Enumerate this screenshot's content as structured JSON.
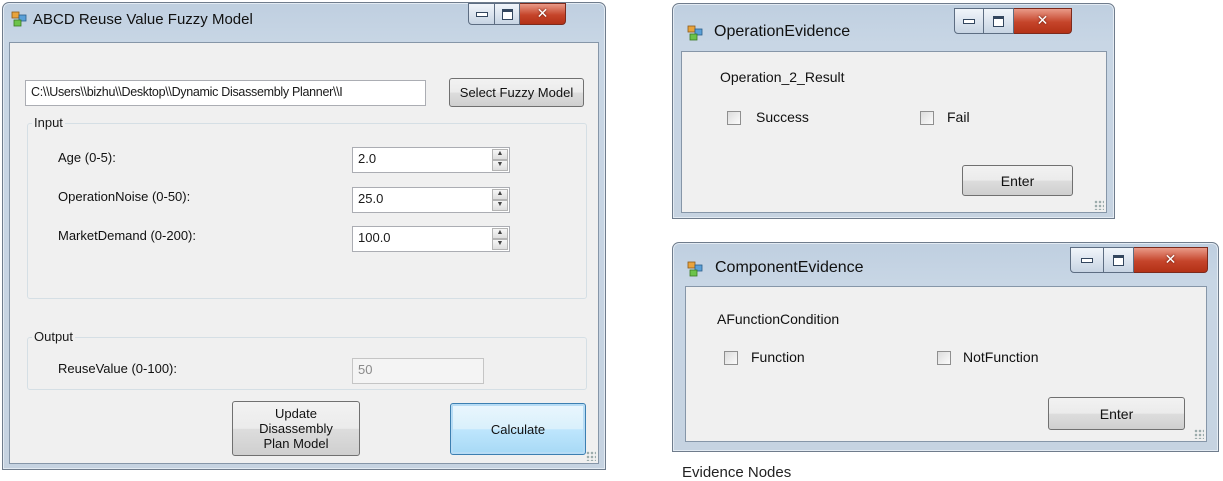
{
  "fuzzy_window": {
    "title": "ABCD Reuse Value Fuzzy Model",
    "path_value": "C:\\\\Users\\\\bizhu\\\\Desktop\\\\Dynamic Disassembly Planner\\\\I",
    "select_button": "Select Fuzzy Model",
    "input_group": {
      "title": "Input",
      "fields": [
        {
          "label": "Age (0-5):",
          "value": "2.0"
        },
        {
          "label": "OperationNoise (0-50):",
          "value": "25.0"
        },
        {
          "label": "MarketDemand (0-200):",
          "value": "100.0"
        }
      ]
    },
    "output_group": {
      "title": "Output",
      "field": {
        "label": "ReuseValue (0-100):",
        "value": "50"
      }
    },
    "update_button": "Update Disassembly Plan Model",
    "calculate_button": "Calculate"
  },
  "operation_window": {
    "title": "OperationEvidence",
    "heading": "Operation_2_Result",
    "options": [
      {
        "label": "Success",
        "checked": false
      },
      {
        "label": "Fail",
        "checked": false
      }
    ],
    "enter_button": "Enter"
  },
  "component_window": {
    "title": "ComponentEvidence",
    "heading": "AFunctionCondition",
    "options": [
      {
        "label": "Function",
        "checked": false
      },
      {
        "label": "NotFunction",
        "checked": false
      }
    ],
    "enter_button": "Enter"
  },
  "caption_fragment": "Evidence Nodes",
  "icons": {
    "app": "app-window-icon",
    "minimize": "minimize-icon",
    "maximize": "maximize-icon",
    "close": "close-icon",
    "spin_up": "spin-up-arrow-icon",
    "spin_down": "spin-down-arrow-icon",
    "grip": "resize-grip-icon"
  },
  "colors": {
    "title_frame": "#c8d6e5",
    "client_bg": "#f0f0f0",
    "close_button": "#c5442a",
    "focus_blue": "#3c7fb1"
  }
}
